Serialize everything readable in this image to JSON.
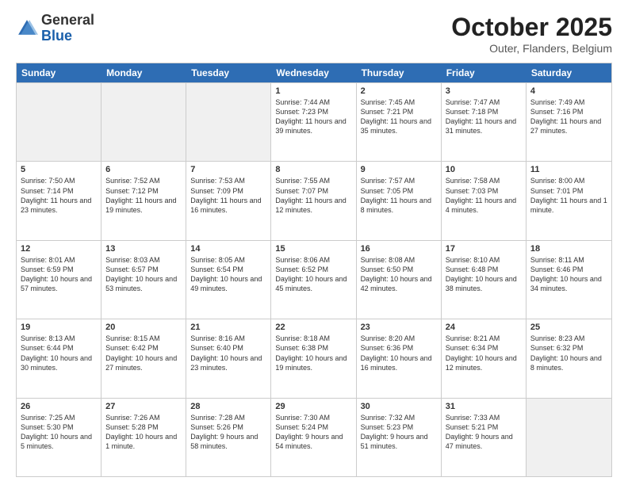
{
  "header": {
    "logo_general": "General",
    "logo_blue": "Blue",
    "month": "October 2025",
    "location": "Outer, Flanders, Belgium"
  },
  "weekdays": [
    "Sunday",
    "Monday",
    "Tuesday",
    "Wednesday",
    "Thursday",
    "Friday",
    "Saturday"
  ],
  "rows": [
    [
      {
        "day": "",
        "info": ""
      },
      {
        "day": "",
        "info": ""
      },
      {
        "day": "",
        "info": ""
      },
      {
        "day": "1",
        "info": "Sunrise: 7:44 AM\nSunset: 7:23 PM\nDaylight: 11 hours and 39 minutes."
      },
      {
        "day": "2",
        "info": "Sunrise: 7:45 AM\nSunset: 7:21 PM\nDaylight: 11 hours and 35 minutes."
      },
      {
        "day": "3",
        "info": "Sunrise: 7:47 AM\nSunset: 7:18 PM\nDaylight: 11 hours and 31 minutes."
      },
      {
        "day": "4",
        "info": "Sunrise: 7:49 AM\nSunset: 7:16 PM\nDaylight: 11 hours and 27 minutes."
      }
    ],
    [
      {
        "day": "5",
        "info": "Sunrise: 7:50 AM\nSunset: 7:14 PM\nDaylight: 11 hours and 23 minutes."
      },
      {
        "day": "6",
        "info": "Sunrise: 7:52 AM\nSunset: 7:12 PM\nDaylight: 11 hours and 19 minutes."
      },
      {
        "day": "7",
        "info": "Sunrise: 7:53 AM\nSunset: 7:09 PM\nDaylight: 11 hours and 16 minutes."
      },
      {
        "day": "8",
        "info": "Sunrise: 7:55 AM\nSunset: 7:07 PM\nDaylight: 11 hours and 12 minutes."
      },
      {
        "day": "9",
        "info": "Sunrise: 7:57 AM\nSunset: 7:05 PM\nDaylight: 11 hours and 8 minutes."
      },
      {
        "day": "10",
        "info": "Sunrise: 7:58 AM\nSunset: 7:03 PM\nDaylight: 11 hours and 4 minutes."
      },
      {
        "day": "11",
        "info": "Sunrise: 8:00 AM\nSunset: 7:01 PM\nDaylight: 11 hours and 1 minute."
      }
    ],
    [
      {
        "day": "12",
        "info": "Sunrise: 8:01 AM\nSunset: 6:59 PM\nDaylight: 10 hours and 57 minutes."
      },
      {
        "day": "13",
        "info": "Sunrise: 8:03 AM\nSunset: 6:57 PM\nDaylight: 10 hours and 53 minutes."
      },
      {
        "day": "14",
        "info": "Sunrise: 8:05 AM\nSunset: 6:54 PM\nDaylight: 10 hours and 49 minutes."
      },
      {
        "day": "15",
        "info": "Sunrise: 8:06 AM\nSunset: 6:52 PM\nDaylight: 10 hours and 45 minutes."
      },
      {
        "day": "16",
        "info": "Sunrise: 8:08 AM\nSunset: 6:50 PM\nDaylight: 10 hours and 42 minutes."
      },
      {
        "day": "17",
        "info": "Sunrise: 8:10 AM\nSunset: 6:48 PM\nDaylight: 10 hours and 38 minutes."
      },
      {
        "day": "18",
        "info": "Sunrise: 8:11 AM\nSunset: 6:46 PM\nDaylight: 10 hours and 34 minutes."
      }
    ],
    [
      {
        "day": "19",
        "info": "Sunrise: 8:13 AM\nSunset: 6:44 PM\nDaylight: 10 hours and 30 minutes."
      },
      {
        "day": "20",
        "info": "Sunrise: 8:15 AM\nSunset: 6:42 PM\nDaylight: 10 hours and 27 minutes."
      },
      {
        "day": "21",
        "info": "Sunrise: 8:16 AM\nSunset: 6:40 PM\nDaylight: 10 hours and 23 minutes."
      },
      {
        "day": "22",
        "info": "Sunrise: 8:18 AM\nSunset: 6:38 PM\nDaylight: 10 hours and 19 minutes."
      },
      {
        "day": "23",
        "info": "Sunrise: 8:20 AM\nSunset: 6:36 PM\nDaylight: 10 hours and 16 minutes."
      },
      {
        "day": "24",
        "info": "Sunrise: 8:21 AM\nSunset: 6:34 PM\nDaylight: 10 hours and 12 minutes."
      },
      {
        "day": "25",
        "info": "Sunrise: 8:23 AM\nSunset: 6:32 PM\nDaylight: 10 hours and 8 minutes."
      }
    ],
    [
      {
        "day": "26",
        "info": "Sunrise: 7:25 AM\nSunset: 5:30 PM\nDaylight: 10 hours and 5 minutes."
      },
      {
        "day": "27",
        "info": "Sunrise: 7:26 AM\nSunset: 5:28 PM\nDaylight: 10 hours and 1 minute."
      },
      {
        "day": "28",
        "info": "Sunrise: 7:28 AM\nSunset: 5:26 PM\nDaylight: 9 hours and 58 minutes."
      },
      {
        "day": "29",
        "info": "Sunrise: 7:30 AM\nSunset: 5:24 PM\nDaylight: 9 hours and 54 minutes."
      },
      {
        "day": "30",
        "info": "Sunrise: 7:32 AM\nSunset: 5:23 PM\nDaylight: 9 hours and 51 minutes."
      },
      {
        "day": "31",
        "info": "Sunrise: 7:33 AM\nSunset: 5:21 PM\nDaylight: 9 hours and 47 minutes."
      },
      {
        "day": "",
        "info": ""
      }
    ]
  ]
}
